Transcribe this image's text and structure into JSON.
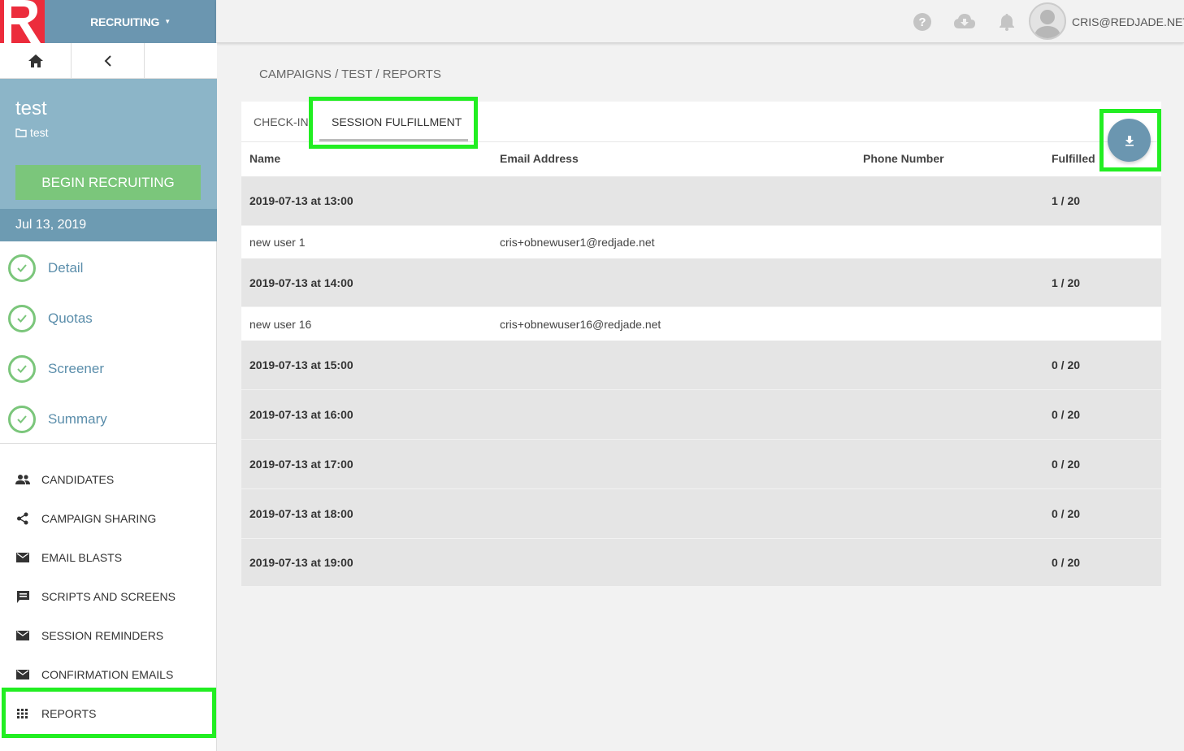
{
  "header": {
    "app_switch_label": "RECRUITING",
    "user_email": "CRIS@REDJADE.NET"
  },
  "campaign": {
    "title": "test",
    "folder": "test",
    "begin_label": "BEGIN RECRUITING",
    "date": "Jul 13, 2019"
  },
  "steps": [
    {
      "label": "Detail"
    },
    {
      "label": "Quotas"
    },
    {
      "label": "Screener"
    },
    {
      "label": "Summary"
    }
  ],
  "menu": [
    {
      "label": "CANDIDATES",
      "icon": "people-icon"
    },
    {
      "label": "CAMPAIGN SHARING",
      "icon": "share-icon"
    },
    {
      "label": "EMAIL BLASTS",
      "icon": "mail-icon"
    },
    {
      "label": "SCRIPTS AND SCREENS",
      "icon": "comment-icon"
    },
    {
      "label": "SESSION REMINDERS",
      "icon": "mail-icon"
    },
    {
      "label": "CONFIRMATION EMAILS",
      "icon": "mail-icon"
    },
    {
      "label": "REPORTS",
      "icon": "grid-icon"
    }
  ],
  "breadcrumb": "CAMPAIGNS / TEST / REPORTS",
  "tabs": [
    {
      "label": "CHECK-IN"
    },
    {
      "label": "SESSION FULFILLMENT"
    }
  ],
  "columns": [
    "Name",
    "Email Address",
    "Phone Number",
    "Fulfilled"
  ],
  "rows": [
    {
      "kind": "session",
      "name": "2019-07-13 at 13:00",
      "email": "",
      "phone": "",
      "fulfilled": "1 / 20"
    },
    {
      "kind": "person",
      "name": "new user 1",
      "email": "cris+obnewuser1@redjade.net",
      "phone": "",
      "fulfilled": ""
    },
    {
      "kind": "session",
      "name": "2019-07-13 at 14:00",
      "email": "",
      "phone": "",
      "fulfilled": "1 / 20"
    },
    {
      "kind": "person",
      "name": "new user 16",
      "email": "cris+obnewuser16@redjade.net",
      "phone": "",
      "fulfilled": ""
    },
    {
      "kind": "session",
      "name": "2019-07-13 at 15:00",
      "email": "",
      "phone": "",
      "fulfilled": "0 / 20"
    },
    {
      "kind": "session",
      "name": "2019-07-13 at 16:00",
      "email": "",
      "phone": "",
      "fulfilled": "0 / 20"
    },
    {
      "kind": "session",
      "name": "2019-07-13 at 17:00",
      "email": "",
      "phone": "",
      "fulfilled": "0 / 20"
    },
    {
      "kind": "session",
      "name": "2019-07-13 at 18:00",
      "email": "",
      "phone": "",
      "fulfilled": "0 / 20"
    },
    {
      "kind": "session",
      "name": "2019-07-13 at 19:00",
      "email": "",
      "phone": "",
      "fulfilled": "0 / 20"
    }
  ],
  "colors": {
    "brand_red": "#ec2c3c",
    "primary_blue": "#6b96b0",
    "success_green": "#7bc67b",
    "highlight_green": "#22ee22"
  }
}
